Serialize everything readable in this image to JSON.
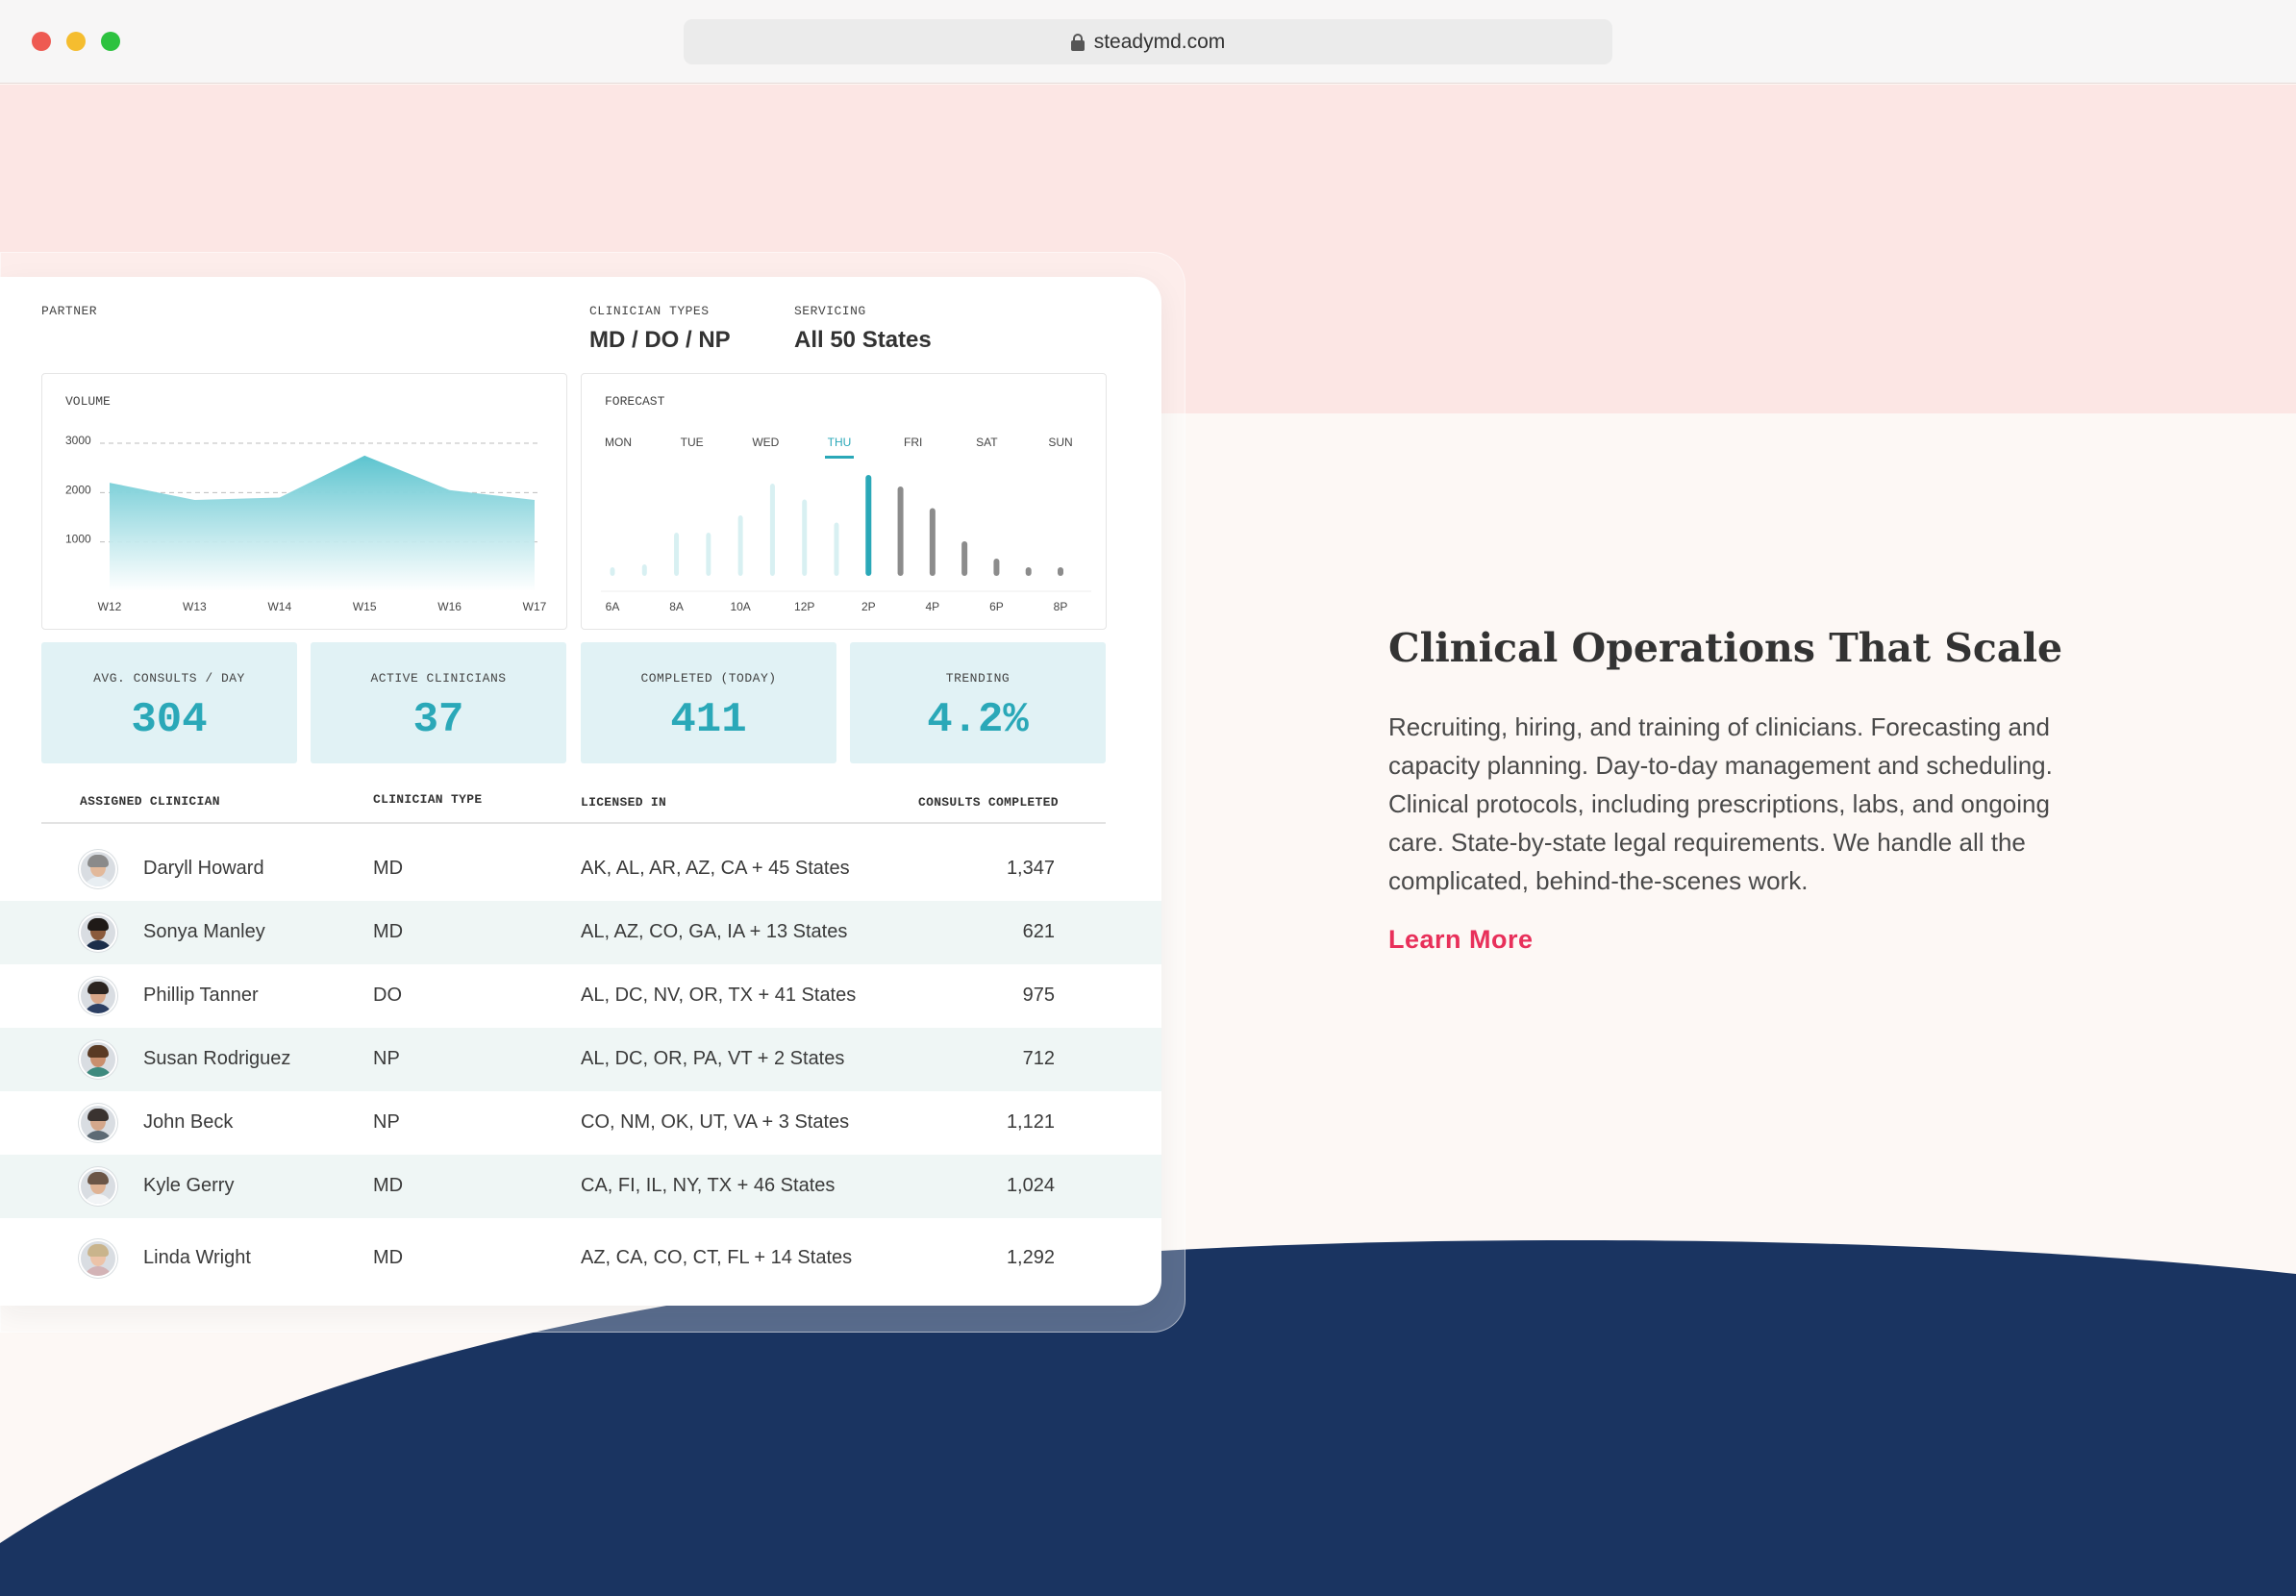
{
  "browser": {
    "url": "steadymd.com"
  },
  "dashboard": {
    "partner_label": "PARTNER",
    "clinician_types_label": "CLINICIAN TYPES",
    "clinician_types_value": "MD / DO / NP",
    "servicing_label": "SERVICING",
    "servicing_value": "All 50 States",
    "volume": {
      "label": "VOLUME",
      "y_ticks": [
        "3000",
        "2000",
        "1000"
      ],
      "x_ticks": [
        "W12",
        "W13",
        "W14",
        "W15",
        "W16",
        "W17"
      ]
    },
    "forecast": {
      "label": "FORECAST",
      "days": [
        "MON",
        "TUE",
        "WED",
        "THU",
        "FRI",
        "SAT",
        "SUN"
      ],
      "selected_day": "THU",
      "hour_ticks": [
        "6A",
        "8A",
        "10A",
        "12P",
        "2P",
        "4P",
        "6P",
        "8P"
      ]
    },
    "stats": [
      {
        "label": "AVG. CONSULTS / DAY",
        "value": "304"
      },
      {
        "label": "ACTIVE CLINICIANS",
        "value": "37"
      },
      {
        "label": "COMPLETED (TODAY)",
        "value": "411"
      },
      {
        "label": "TRENDING",
        "value": "4.2%"
      }
    ],
    "table": {
      "headers": [
        "ASSIGNED CLINICIAN",
        "CLINICIAN TYPE",
        "LICENSED IN",
        "CONSULTS COMPLETED"
      ],
      "rows": [
        {
          "name": "Daryll Howard",
          "type": "MD",
          "licensed": "AK, AL, AR, AZ, CA + 45 States",
          "consults": "1,347"
        },
        {
          "name": "Sonya Manley",
          "type": "MD",
          "licensed": "AL, AZ, CO, GA, IA + 13 States",
          "consults": "621"
        },
        {
          "name": "Phillip Tanner",
          "type": "DO",
          "licensed": "AL, DC, NV, OR, TX + 41 States",
          "consults": "975"
        },
        {
          "name": "Susan Rodriguez",
          "type": "NP",
          "licensed": "AL, DC, OR, PA, VT + 2 States",
          "consults": "712"
        },
        {
          "name": "John Beck",
          "type": "NP",
          "licensed": "CO, NM, OK, UT, VA + 3 States",
          "consults": "1,121"
        },
        {
          "name": "Kyle Gerry",
          "type": "MD",
          "licensed": "CA, FI, IL, NY, TX + 46 States",
          "consults": "1,024"
        },
        {
          "name": "Linda Wright",
          "type": "MD",
          "licensed": "AZ, CA, CO, CT, FL + 14 States",
          "consults": "1,292"
        }
      ]
    }
  },
  "chart_data": [
    {
      "type": "area",
      "title": "VOLUME",
      "x": [
        "W12",
        "W13",
        "W14",
        "W15",
        "W16",
        "W17"
      ],
      "y_points": [
        {
          "x": "W12",
          "y": 2200
        },
        {
          "x": "W13",
          "y": 1850
        },
        {
          "x": "W14",
          "y": 1900
        },
        {
          "x": "W15",
          "y": 2750
        },
        {
          "x": "W16",
          "y": 2050
        },
        {
          "x": "W17",
          "y": 1850
        }
      ],
      "ylim": [
        0,
        3000
      ],
      "y_ticks": [
        1000,
        2000,
        3000
      ],
      "grid": true
    },
    {
      "type": "bar",
      "title": "FORECAST",
      "x_ticks": [
        "6A",
        "8A",
        "10A",
        "12P",
        "2P",
        "4P",
        "6P",
        "8P"
      ],
      "bars": [
        {
          "hour": 6,
          "value": 6,
          "state": "past"
        },
        {
          "hour": 7,
          "value": 8,
          "state": "past"
        },
        {
          "hour": 8,
          "value": 30,
          "state": "past"
        },
        {
          "hour": 9,
          "value": 30,
          "state": "past"
        },
        {
          "hour": 10,
          "value": 42,
          "state": "past"
        },
        {
          "hour": 11,
          "value": 64,
          "state": "past"
        },
        {
          "hour": 12,
          "value": 53,
          "state": "past"
        },
        {
          "hour": 13,
          "value": 37,
          "state": "past"
        },
        {
          "hour": 14,
          "value": 70,
          "state": "current"
        },
        {
          "hour": 15,
          "value": 62,
          "state": "future"
        },
        {
          "hour": 16,
          "value": 47,
          "state": "future"
        },
        {
          "hour": 17,
          "value": 24,
          "state": "future"
        },
        {
          "hour": 18,
          "value": 12,
          "state": "future"
        },
        {
          "hour": 19,
          "value": 6,
          "state": "future"
        },
        {
          "hour": 20,
          "value": 6,
          "state": "future"
        }
      ],
      "ylim": [
        0,
        80
      ]
    }
  ],
  "hero": {
    "headline": "Clinical Operations That Scale",
    "body": "Recruiting, hiring, and training of clinicians. Forecasting and capacity planning. Day-to-day management and scheduling. Clinical protocols, including prescriptions, labs, and ongoing care. State-by-state legal requirements. We handle all the complicated, behind-the-scenes work.",
    "cta": "Learn More"
  },
  "colors": {
    "accent_teal": "#2aa8b8",
    "navy": "#1a3461",
    "cta_pink": "#e8305a",
    "pink_band": "#fce6e4"
  }
}
